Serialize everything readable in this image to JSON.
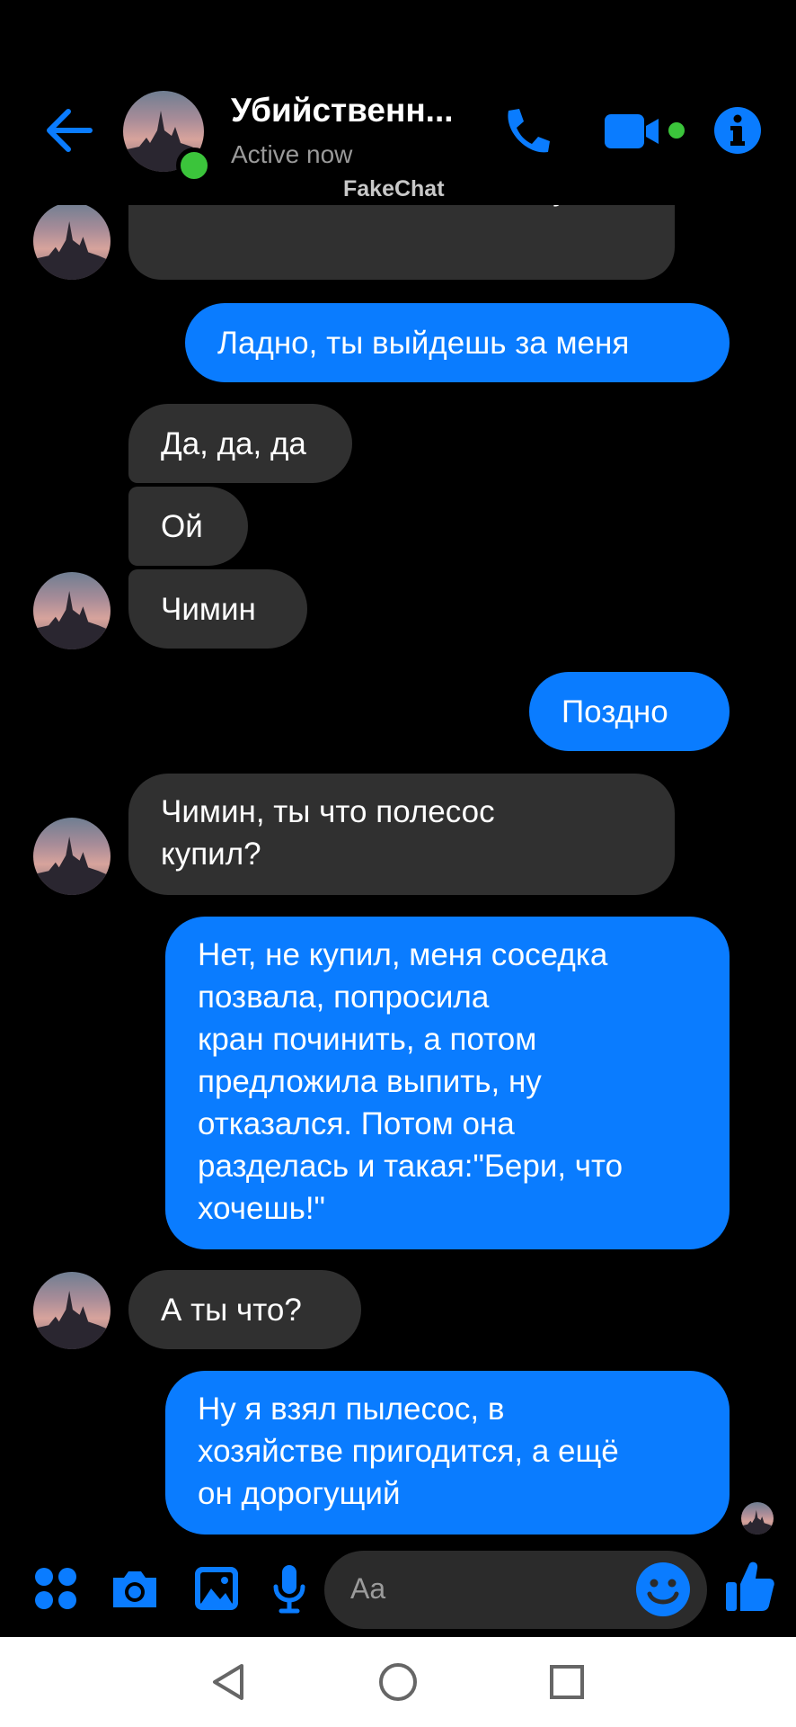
{
  "header": {
    "contact_name": "Убийственн...",
    "status": "Active now",
    "watermark": "FakeChat"
  },
  "messages": [
    {
      "from": "them",
      "text": "Я знаю сложно любить такую"
    },
    {
      "from": "me",
      "text": "Ладно, ты выйдешь за меня"
    },
    {
      "from": "them",
      "text": "Да, да, да"
    },
    {
      "from": "them",
      "text": "Ой"
    },
    {
      "from": "them",
      "text": "Чимин"
    },
    {
      "from": "me",
      "text": "Поздно"
    },
    {
      "from": "them",
      "text": "Чимин, ты что полесос\nкупил?"
    },
    {
      "from": "me",
      "text": "Нет, не купил, меня соседка\nпозвала, попросила\nкран починить, а потом\nпредложила выпить, ну\nотказался. Потом она\nразделась и такая:\"Бери, что\nхочешь!\""
    },
    {
      "from": "them",
      "text": "А ты что?"
    },
    {
      "from": "me",
      "text": "Ну я взял пылесос, в\nхозяйстве пригодится, а ещё\nон дорогущий"
    }
  ],
  "composer": {
    "placeholder": "Aa"
  },
  "icons": {
    "back": "back-arrow-icon",
    "call": "phone-icon",
    "video": "video-camera-icon",
    "info": "info-icon",
    "apps": "apps-grid-icon",
    "camera": "camera-icon",
    "gallery": "gallery-icon",
    "mic": "microphone-icon",
    "emoji": "emoji-icon",
    "like": "thumbs-up-icon",
    "nav_back": "nav-back-icon",
    "nav_home": "nav-home-icon",
    "nav_recents": "nav-recents-icon"
  },
  "colors": {
    "accent": "#0a7cff",
    "incoming_bubble": "#303030",
    "background": "#000000",
    "presence": "#3bc43b"
  }
}
